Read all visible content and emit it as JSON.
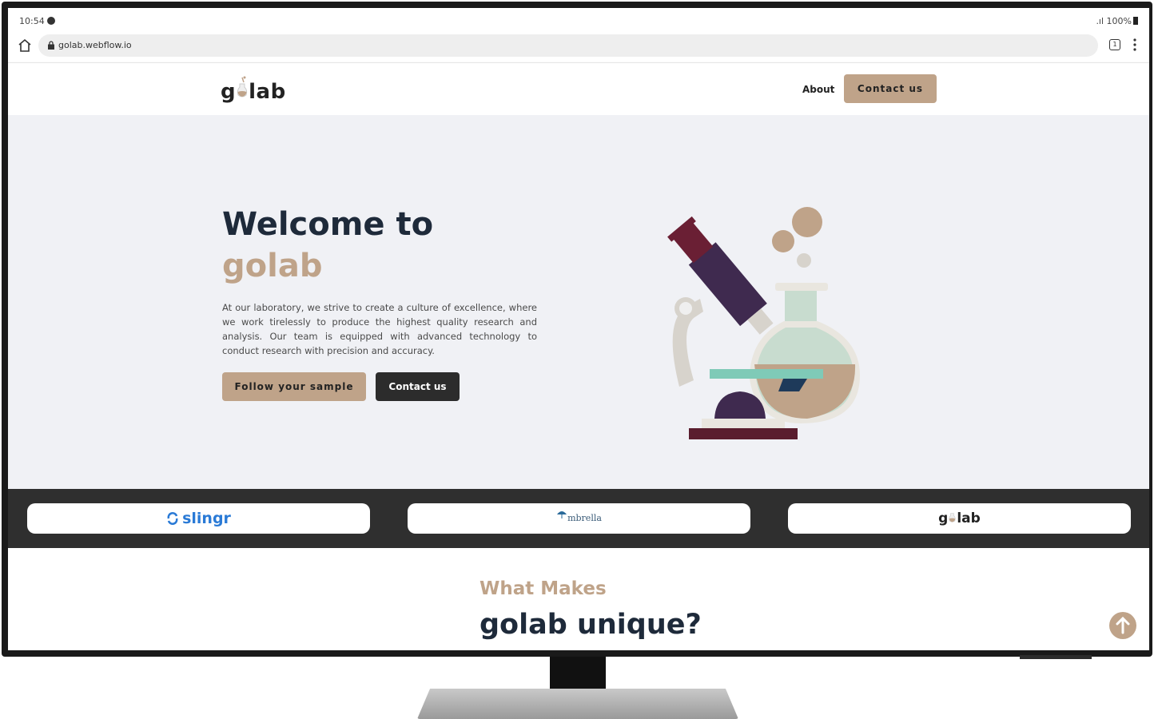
{
  "status_bar": {
    "time": "10:54",
    "battery": "100%"
  },
  "browser": {
    "url": "golab.webflow.io",
    "tab_count": "1"
  },
  "nav": {
    "logo_prefix": "g",
    "logo_suffix": "lab",
    "about": "About",
    "contact": "Contact us"
  },
  "hero": {
    "title_line1": "Welcome to",
    "title_line2": "golab",
    "description": "At our laboratory, we strive to create a culture of excellence, where we work tirelessly to produce the highest quality research and analysis. Our team is equipped with advanced technology to conduct research with precision and accuracy.",
    "follow_button": "Follow your sample",
    "contact_button": "Contact us"
  },
  "partners": [
    {
      "name": "slingr"
    },
    {
      "name": "mbrella"
    },
    {
      "name": "lab",
      "prefix": "g"
    }
  ],
  "unique": {
    "subtitle": "What Makes",
    "title": "golab unique?"
  },
  "colors": {
    "accent": "#bfa389",
    "dark": "#1e2a3a",
    "hero_bg": "#f0f1f5",
    "strip_bg": "#2f2f2f",
    "slingr_blue": "#2a7ad6"
  }
}
